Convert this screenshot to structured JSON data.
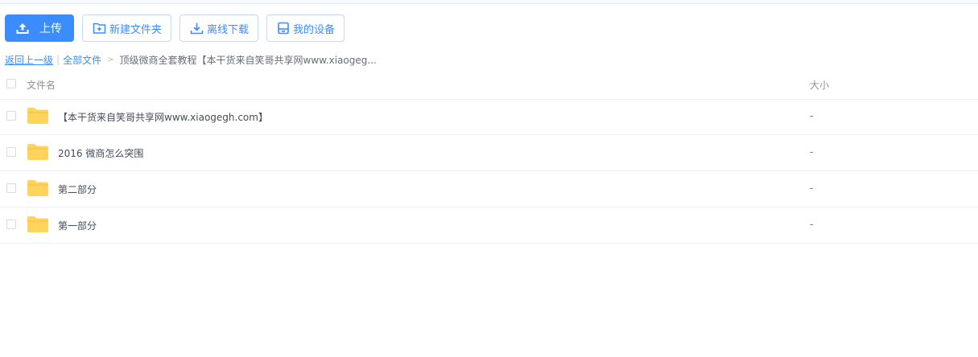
{
  "toolbar": {
    "upload_label": "上传",
    "new_folder_label": "新建文件夹",
    "offline_download_label": "离线下载",
    "my_devices_label": "我的设备"
  },
  "breadcrumb": {
    "back": "返回上一级",
    "divider": "|",
    "all_files": "全部文件",
    "arrow": ">",
    "current": "顶级微商全套教程【本干货来自笑哥共享网www.xiaogeg..."
  },
  "table": {
    "columns": {
      "name": "文件名",
      "size": "大小"
    },
    "rows": [
      {
        "name": "【本干货来自笑哥共享网www.xiaogegh.com】",
        "size": "-"
      },
      {
        "name": "2016 微商怎么突围",
        "size": "-"
      },
      {
        "name": "第二部分",
        "size": "-"
      },
      {
        "name": "第一部分",
        "size": "-"
      }
    ]
  },
  "colors": {
    "accent": "#3b8cff",
    "folder": "#ffd45c"
  }
}
